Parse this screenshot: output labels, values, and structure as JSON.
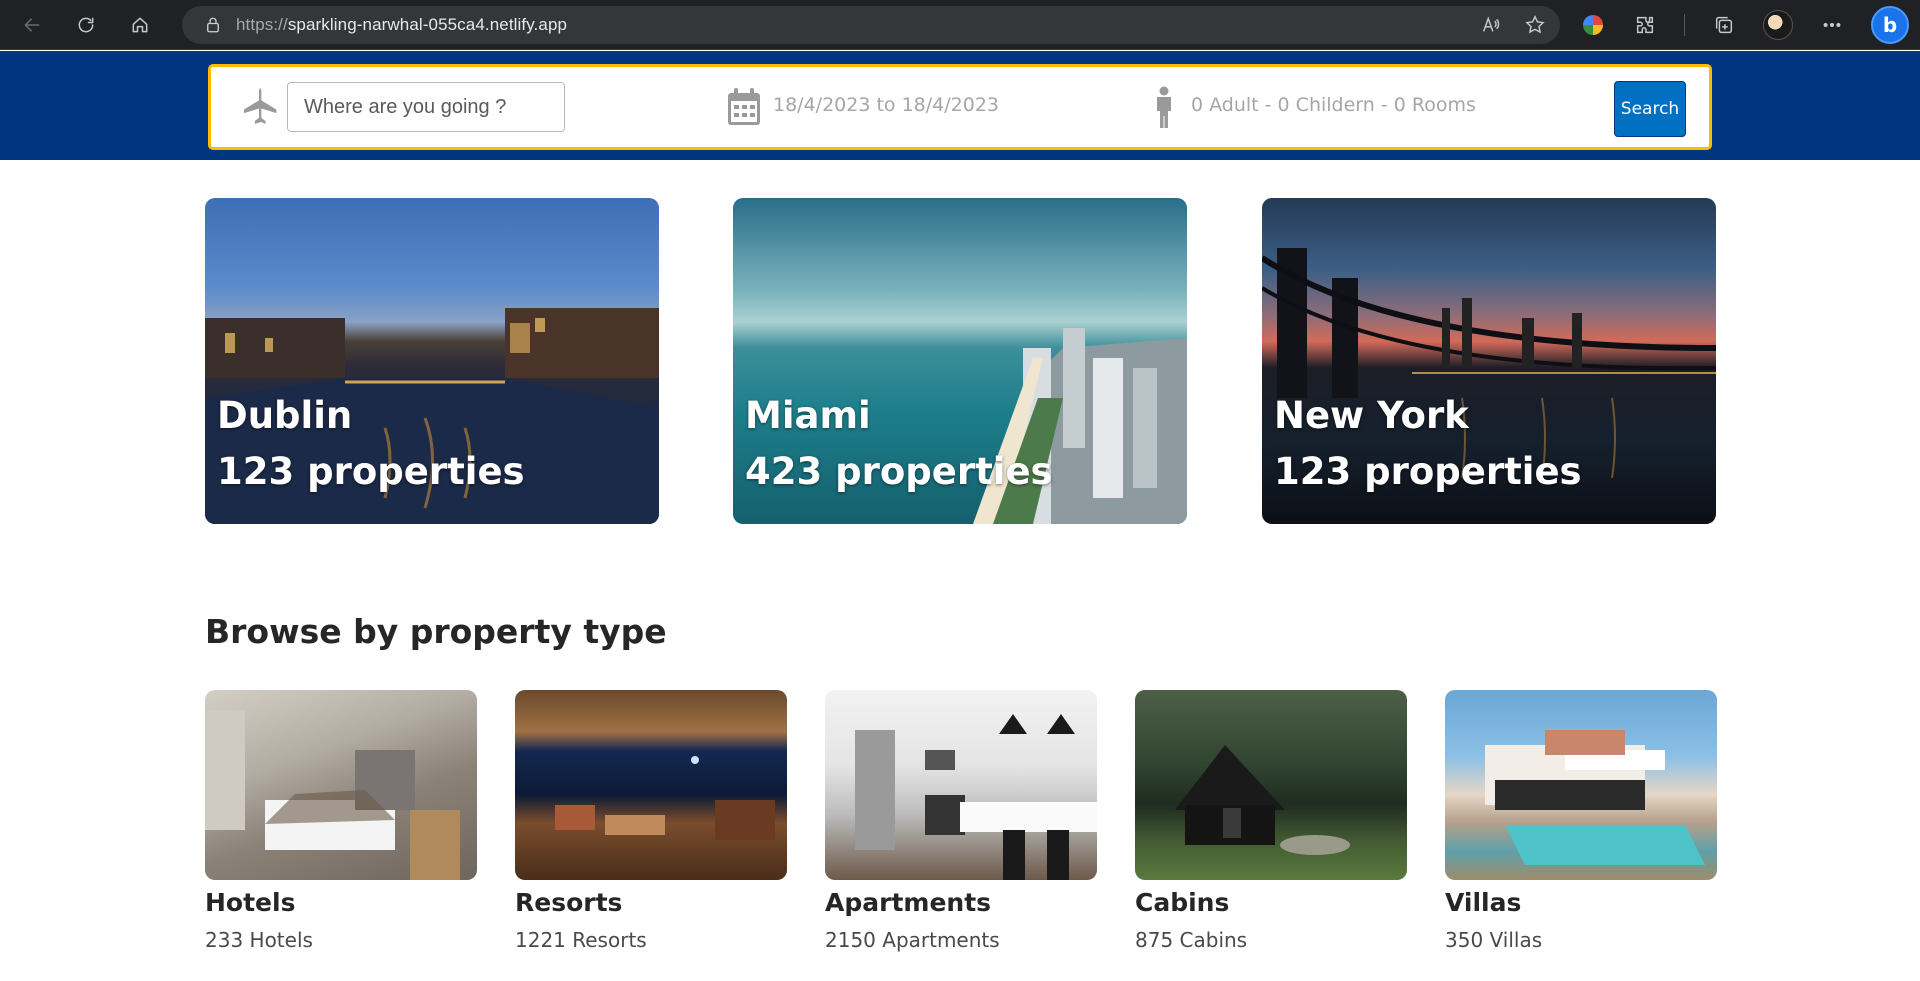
{
  "browser": {
    "url_protocol": "https://",
    "url_host": "sparkling-narwhal-055ca4.netlify.app"
  },
  "search": {
    "destination_placeholder": "Where are you going ?",
    "date_range": "18/4/2023 to 18/4/2023",
    "guests": "0 Adult - 0 Childern - 0 Rooms",
    "button_label": "Search"
  },
  "featured": [
    {
      "city": "Dublin",
      "properties": "123 properties"
    },
    {
      "city": "Miami",
      "properties": "423 properties"
    },
    {
      "city": "New York",
      "properties": "123 properties"
    }
  ],
  "property_types": {
    "title": "Browse by property type",
    "items": [
      {
        "name": "Hotels",
        "count": "233 Hotels"
      },
      {
        "name": "Resorts",
        "count": "1221 Resorts"
      },
      {
        "name": "Apartments",
        "count": "2150 Apartments"
      },
      {
        "name": "Cabins",
        "count": "875 Cabins"
      },
      {
        "name": "Villas",
        "count": "350 Villas"
      }
    ]
  },
  "colors": {
    "header_bg": "#003580",
    "search_border": "#febb02",
    "search_button": "#0071c2"
  }
}
